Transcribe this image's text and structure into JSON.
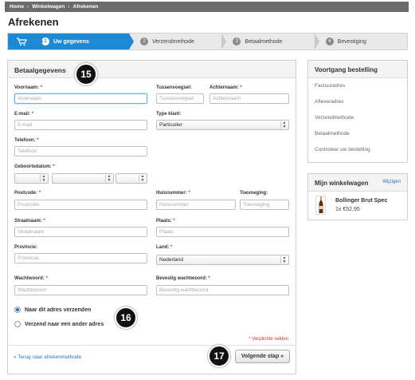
{
  "breadcrumb": [
    "Home",
    "Winkelwagen",
    "Afrekenen"
  ],
  "page_title": "Afrekenen",
  "steps": [
    {
      "num": "1",
      "label": "Uw gegevens"
    },
    {
      "num": "2",
      "label": "Verzendmethode"
    },
    {
      "num": "3",
      "label": "Betaalmethode"
    },
    {
      "num": "4",
      "label": "Bevestiging"
    }
  ],
  "form": {
    "title": "Betaalgegevens",
    "req_mark": "*",
    "voornaam": {
      "label": "Voornaam:",
      "placeholder": "Voornaam"
    },
    "tussenvoegsel": {
      "label": "Tussenvoegsel:",
      "placeholder": "Tussenvoegsel"
    },
    "achternaam": {
      "label": "Achternaam:",
      "placeholder": "Achternaam"
    },
    "email": {
      "label": "E-mail:",
      "placeholder": "E-mail"
    },
    "type_klant": {
      "label": "Type klant:",
      "value": "Particulier"
    },
    "telefoon": {
      "label": "Telefoon:",
      "placeholder": "Telefoon"
    },
    "geboortedatum": {
      "label": "Geboortedatum:"
    },
    "postcode": {
      "label": "Postcode:",
      "placeholder": "Postcode"
    },
    "huisnummer": {
      "label": "Huisnummer:",
      "placeholder": "Huisnummer"
    },
    "toevoeging": {
      "label": "Toevoeging:",
      "placeholder": "Toevoeging"
    },
    "straatnaam": {
      "label": "Straatnaam:",
      "placeholder": "Straatnaam"
    },
    "plaats": {
      "label": "Plaats:",
      "placeholder": "Plaats"
    },
    "provincie": {
      "label": "Provincie:",
      "placeholder": "Provincie"
    },
    "land": {
      "label": "Land:",
      "value": "Nederland"
    },
    "wachtwoord": {
      "label": "Wachtwoord:",
      "placeholder": "Wachtwoord"
    },
    "bevestig": {
      "label": "Bevestig wachtwoord:",
      "placeholder": "Bevestig wachtwoord"
    },
    "radio_ship_same": "Naar dit adres verzenden",
    "radio_ship_other": "Verzend naar een ander adres",
    "required_note": "* Verplichte velden",
    "back_link": "« Terug naar afrekenmethode",
    "next_button": "Volgende stap »"
  },
  "badges": [
    "15",
    "16",
    "17"
  ],
  "progress": {
    "title": "Voortgang bestelling",
    "items": [
      "Factuuradres",
      "Afleveradres",
      "Verzendmethode",
      "Betaalmethode",
      "Controleer uw bestelling"
    ]
  },
  "cart": {
    "title": "Mijn winkelwagen",
    "edit": "Wijzigen",
    "item_name": "Bollinger Brut Spec",
    "item_price": "1x €52,95"
  },
  "colors": {
    "accent": "#1e8ad6",
    "required": "#c0392b",
    "link": "#1e75c8"
  }
}
